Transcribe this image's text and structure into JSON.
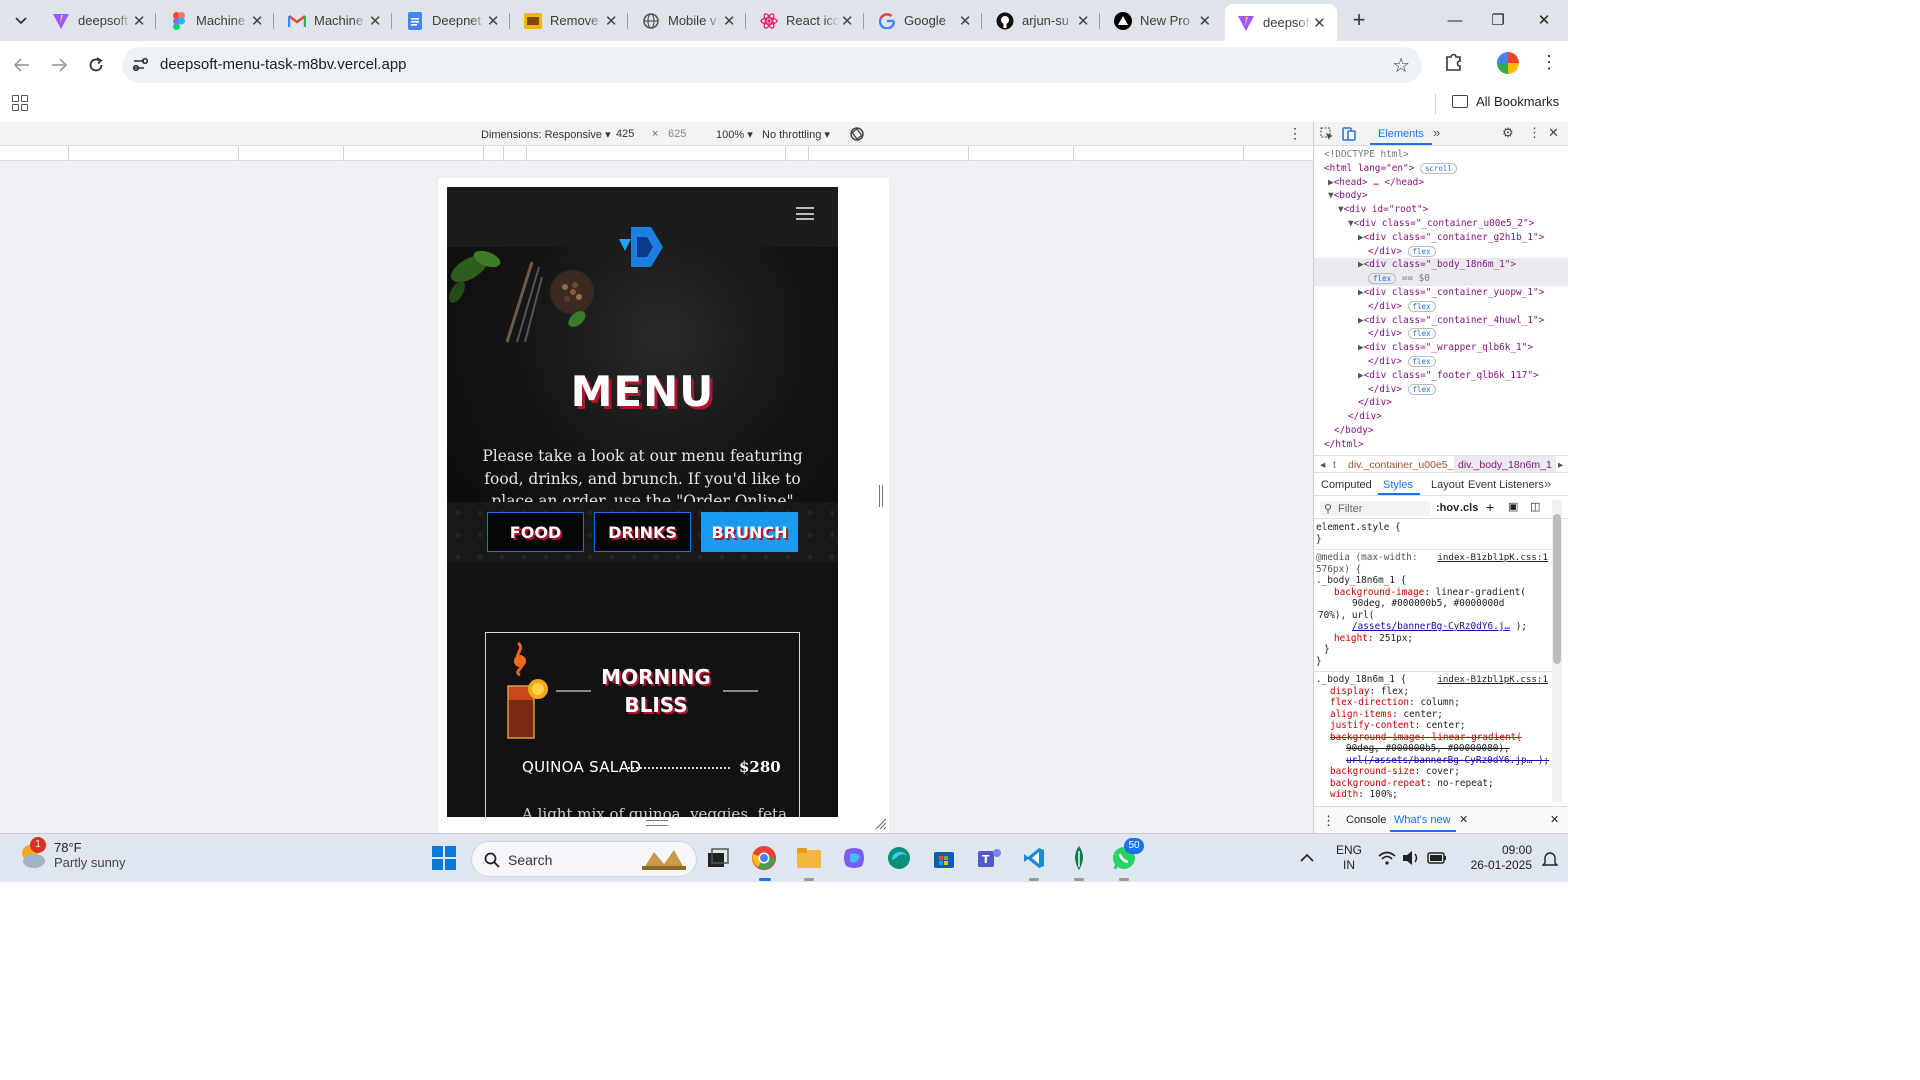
{
  "browser": {
    "tabs": [
      {
        "title": "deepsoft",
        "icon": "vite-icon",
        "color": "#9c59ff"
      },
      {
        "title": "Machine",
        "icon": "figma-icon",
        "color": "#f24e1e"
      },
      {
        "title": "Machine",
        "icon": "gmail-icon",
        "color": "#ea4335"
      },
      {
        "title": "Deepnet",
        "icon": "docs-icon",
        "color": "#4285f4"
      },
      {
        "title": "Remove",
        "icon": "slides-icon",
        "color": "#f4b400"
      },
      {
        "title": "Mobile v",
        "icon": "globe-icon",
        "color": "#555555"
      },
      {
        "title": "React ico",
        "icon": "react-icons-icon",
        "color": "#e91e63"
      },
      {
        "title": "Google",
        "icon": "google-icon",
        "color": "#4285f4"
      },
      {
        "title": "arjun-su",
        "icon": "github-icon",
        "color": "#111111"
      },
      {
        "title": "New Pro",
        "icon": "vercel-icon",
        "color": "#000000"
      },
      {
        "title": "deepsoft",
        "icon": "vite-icon",
        "color": "#9c59ff",
        "active": true
      }
    ],
    "url": "deepsoft-menu-task-m8bv.vercel.app",
    "bookmarks_label": "All Bookmarks"
  },
  "device_toolbar": {
    "dimensions_label": "Dimensions: Responsive",
    "width": "425",
    "height": "625",
    "zoom": "100%",
    "throttling": "No throttling"
  },
  "page": {
    "menu_title": "MENU",
    "hero_text": "Please take a look at our menu featuring food, drinks, and brunch. If you'd like to place an order, use the \"Order Online\" button located below the menu.",
    "tabs": [
      "FOOD",
      "DRINKS",
      "BRUNCH"
    ],
    "active_tab": "BRUNCH",
    "card_title_line1": "MORNING",
    "card_title_line2": "BLISS",
    "item_name": "QUINOA SALAD",
    "item_price": "$280",
    "item_desc": "A light mix of quinoa, veggies, feta",
    "accent_blue": "#1a9bf0",
    "accent_red": "#b0142c"
  },
  "devtools": {
    "tabs": {
      "elements": "Elements"
    },
    "dom_lines": [
      "<!DOCTYPE html>",
      "<html lang=\"en\">",
      "<head> … </head>",
      "<body>",
      "<div id=\"root\">",
      "<div class=\"_container_u00e5_2\">",
      "<div class=\"_container_g2h1b_1\">",
      "</div>",
      "<div class=\"_body_18n6m_1\">",
      "== $0",
      "<div class=\"_container_yuopw_1\">",
      "</div>",
      "<div class=\"_container_4huwl_1\">",
      "</div>",
      "<div class=\"_wrapper_qlb6k_1\">",
      "</div>",
      "<div class=\"_footer_qlb6k_117\">",
      "</div>",
      "</div>",
      "</div>",
      "</body>",
      "</html>"
    ],
    "pill_scroll": "scroll",
    "pill_flex": "flex",
    "breadcrumbs": [
      "t",
      "div._container_u00e5_2",
      "div._body_18n6m_1"
    ],
    "style_tabs": [
      "Computed",
      "Styles",
      "Layout",
      "Event Listeners"
    ],
    "filter_placeholder": "Filter",
    "hov": ":hov",
    "cls": ".cls",
    "css": {
      "element_style": "element.style {",
      "close": "}",
      "media": "@media (max-width:",
      "media2": "576px) {",
      "source": "index-B1zbl1pK.css:1",
      "selector": "._body_18n6m_1 {",
      "bg_image_prop": "background-image",
      "bg_image_val": "linear-gradient(",
      "bg_image_val2": "90deg, #000000b5, #0000000d",
      "bg_image_val3": "70%), url(",
      "bg_url": "/assets/bannerBg-CyRz0dY6.j…",
      "bg_url_end": ");",
      "height_prop": "height",
      "height_val": "251px;",
      "display_prop": "display",
      "display_val": "flex;",
      "flexdir_prop": "flex-direction",
      "flexdir_val": "column;",
      "align_prop": "align-items",
      "align_val": "center;",
      "justify_prop": "justify-content",
      "justify_val": "center;",
      "bgimg_struck": "background-image: linear-gradient(",
      "bgimg_struck2": "90deg, #000000b5, #00000080),",
      "bgimg_struck3": "url(/assets/bannerBg-CyRz0dY6.jp… );",
      "bgsize_prop": "background-size",
      "bgsize_val": "cover;",
      "bgrepeat_prop": "background-repeat",
      "bgrepeat_val": "no-repeat;",
      "width_prop": "width",
      "width_val": "100%;"
    },
    "drawer": {
      "console": "Console",
      "whats_new": "What's new"
    }
  },
  "taskbar": {
    "weather_temp": "78°F",
    "weather_cond": "Partly sunny",
    "weather_badge": "1",
    "search_label": "Search",
    "whatsapp_badge": "50",
    "lang1": "ENG",
    "lang2": "IN",
    "time": "09:00",
    "date": "26-01-2025"
  }
}
